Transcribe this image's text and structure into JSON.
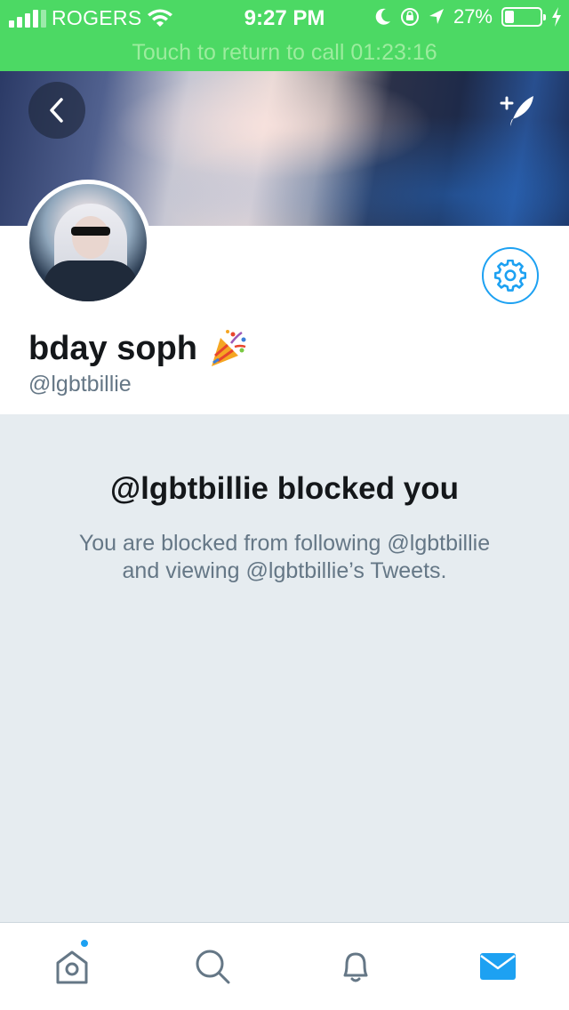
{
  "status_bar": {
    "carrier": "ROGERS",
    "time": "9:27 PM",
    "battery_percent": "27%",
    "battery_level": 0.27,
    "icons": [
      "signal-icon",
      "wifi-icon",
      "moon-icon",
      "rotation-lock-icon",
      "location-icon",
      "battery-icon",
      "charging-icon"
    ]
  },
  "call_banner": {
    "text": "Touch to return to call 01:23:16"
  },
  "header": {
    "back_icon": "chevron-left-icon",
    "compose_icon": "compose-tweet-icon"
  },
  "profile": {
    "display_name": "bday soph",
    "name_emoji": "party-popper-icon",
    "handle": "@lgbtbillie",
    "settings_icon": "gear-icon"
  },
  "blocked": {
    "title": "@lgbtbillie blocked you",
    "line1": "You are blocked from following @lgbtbillie",
    "line2": "and viewing @lgbtbillie’s Tweets."
  },
  "tabbar": {
    "tabs": [
      {
        "name": "home",
        "icon": "home-icon",
        "has_dot": true
      },
      {
        "name": "search",
        "icon": "search-icon"
      },
      {
        "name": "notifications",
        "icon": "bell-icon"
      },
      {
        "name": "messages",
        "icon": "mail-icon",
        "active": true
      }
    ],
    "accent": "#1da1f2"
  },
  "colors": {
    "status_green": "#4cd964",
    "twitter_blue": "#1da1f2",
    "background": "#e6ecf0",
    "text_secondary": "#657786"
  }
}
